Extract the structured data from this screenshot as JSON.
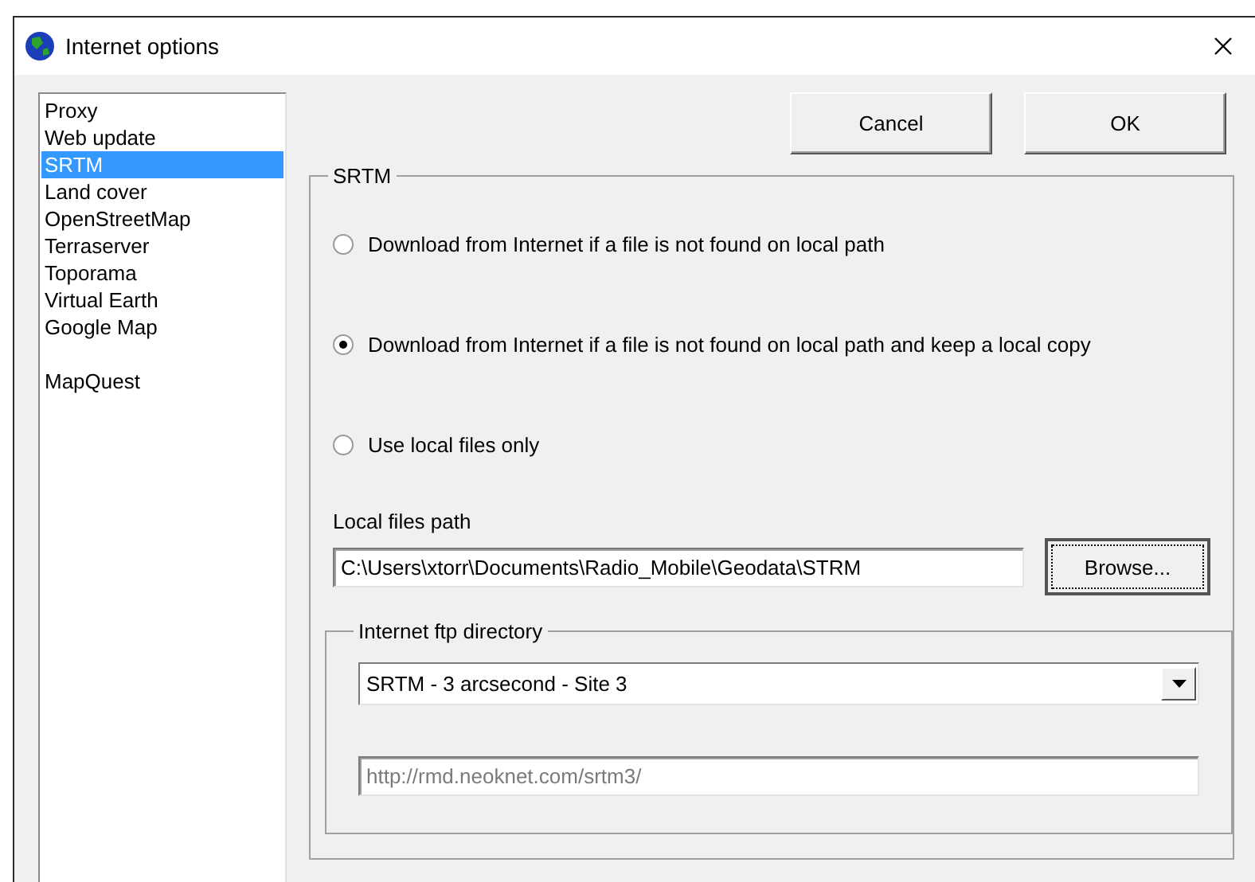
{
  "window": {
    "title": "Internet options"
  },
  "sidebar": {
    "items": [
      {
        "kind": "item",
        "label": "Proxy",
        "selected": false
      },
      {
        "kind": "item",
        "label": "Web update",
        "selected": false
      },
      {
        "kind": "item",
        "label": "SRTM",
        "selected": true
      },
      {
        "kind": "item",
        "label": "Land cover",
        "selected": false
      },
      {
        "kind": "item",
        "label": "OpenStreetMap",
        "selected": false
      },
      {
        "kind": "item",
        "label": "Terraserver",
        "selected": false
      },
      {
        "kind": "item",
        "label": "Toporama",
        "selected": false
      },
      {
        "kind": "item",
        "label": "Virtual Earth",
        "selected": false
      },
      {
        "kind": "item",
        "label": "Google Map",
        "selected": false
      },
      {
        "kind": "blank"
      },
      {
        "kind": "item",
        "label": "MapQuest",
        "selected": false
      }
    ]
  },
  "buttons": [
    {
      "label": "Cancel"
    },
    {
      "label": "OK"
    }
  ],
  "group": {
    "title": "SRTM",
    "options": [
      {
        "label": "Download from Internet if a file is not found on local path",
        "selected": false
      },
      {
        "label": "Download from Internet if a file is not found on local path and keep a local copy",
        "selected": true
      },
      {
        "label": "Use local files only",
        "selected": false
      }
    ],
    "local_path": {
      "label": "Local files path",
      "value": "C:\\Users\\xtorr\\Documents\\Radio_Mobile\\Geodata\\STRM",
      "browse": "Browse..."
    },
    "ftp": {
      "title": "Internet ftp directory",
      "selection": "SRTM - 3 arcsecond - Site 3",
      "url": "http://rmd.neoknet.com/srtm3/"
    }
  }
}
